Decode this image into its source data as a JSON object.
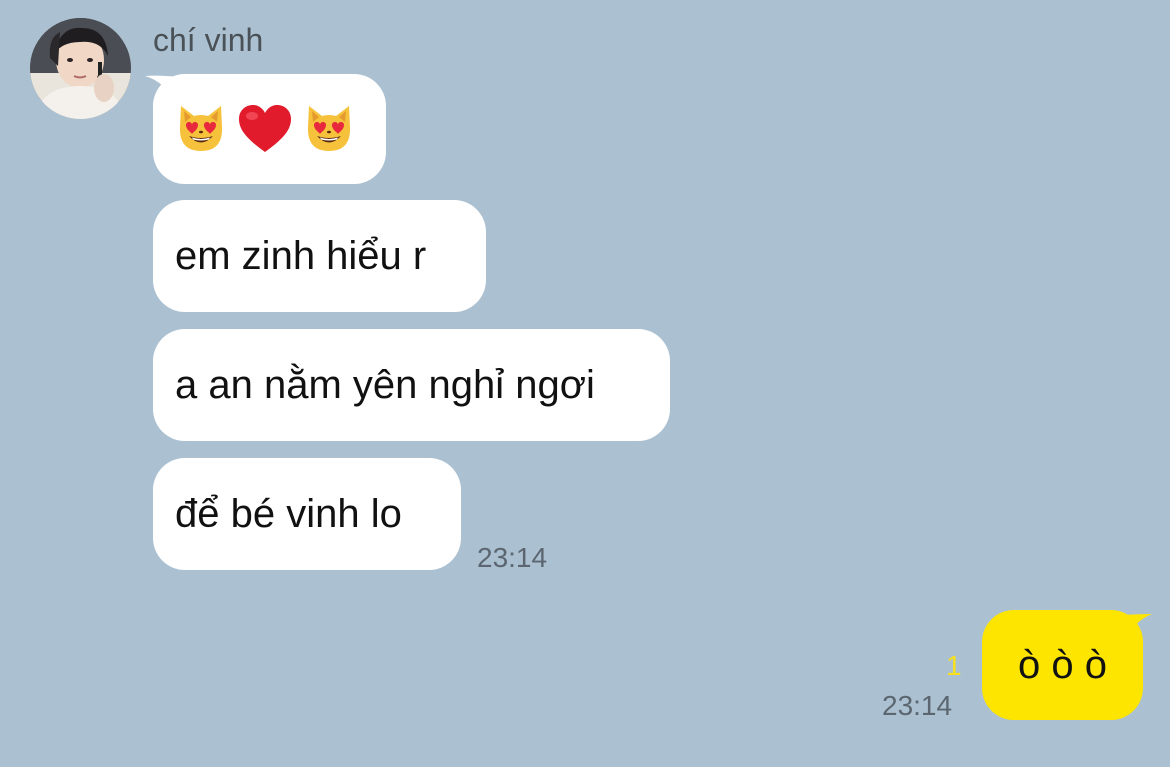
{
  "chat": {
    "sender_name": "chí vinh",
    "incoming": [
      {
        "type": "emoji",
        "icons": [
          "smiling-cat-heart-eyes",
          "red-heart",
          "smiling-cat-heart-eyes"
        ]
      },
      {
        "type": "text",
        "text": "em zinh hiểu r"
      },
      {
        "type": "text",
        "text": "a an nằm yên nghỉ ngơi"
      },
      {
        "type": "text",
        "text": "để bé vinh lo"
      }
    ],
    "incoming_time": "23:14",
    "outgoing": {
      "text": "ò ò ò",
      "unread_count": "1",
      "time": "23:14"
    }
  },
  "colors": {
    "background": "#abc1d1",
    "incoming_bubble": "#ffffff",
    "outgoing_bubble": "#fde500",
    "unread_count": "#f7e01d",
    "timestamp": "#5c6670"
  }
}
